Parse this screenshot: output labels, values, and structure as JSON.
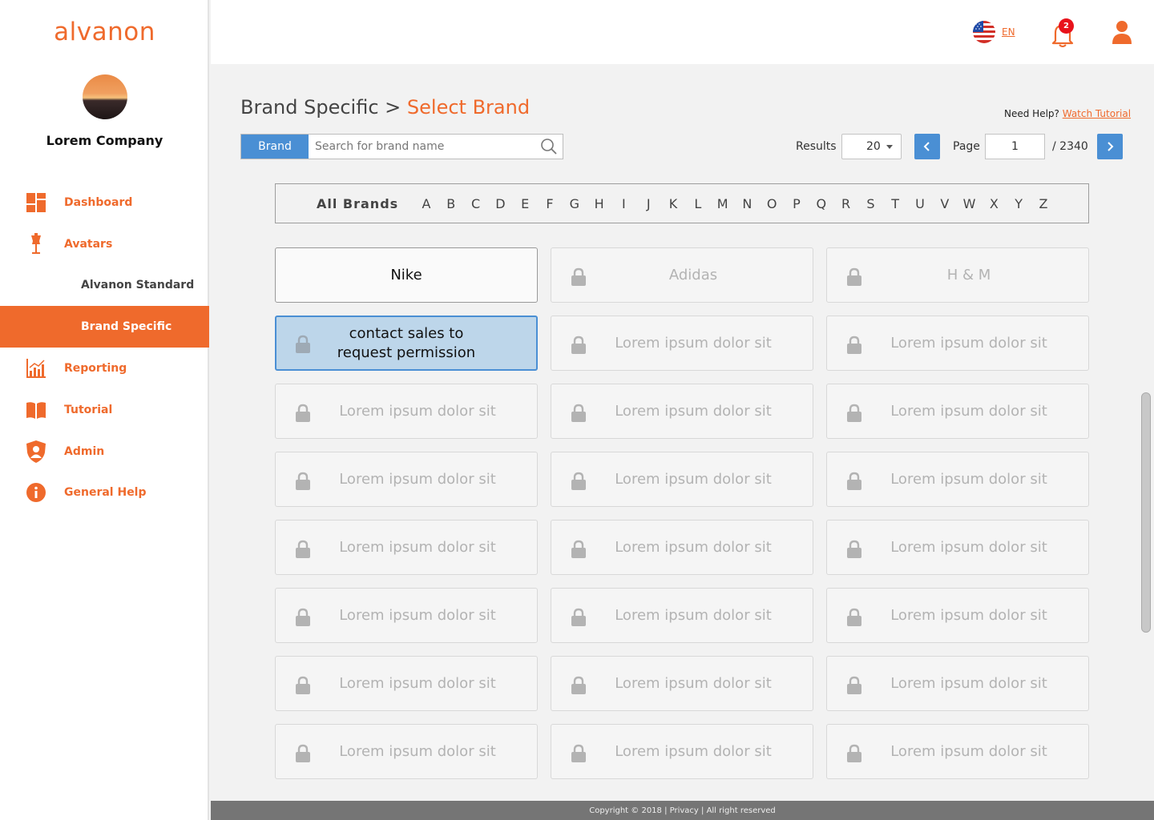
{
  "sidebar": {
    "logo": "alvanon",
    "company": "Lorem Company",
    "nav": [
      {
        "label": "Dashboard",
        "icon": "dashboard-icon"
      },
      {
        "label": "Avatars",
        "icon": "mannequin-icon"
      },
      {
        "label": "Alvanon Standard"
      },
      {
        "label": "Brand Specific",
        "active": true
      },
      {
        "label": "Reporting",
        "icon": "chart-icon"
      },
      {
        "label": "Tutorial",
        "icon": "book-icon"
      },
      {
        "label": "Admin",
        "icon": "shield-user-icon"
      },
      {
        "label": "General Help",
        "icon": "info-icon"
      }
    ]
  },
  "topbar": {
    "language": "EN",
    "notification_count": "2"
  },
  "header": {
    "crumb_parent": "Brand Specific",
    "crumb_sep": ">",
    "crumb_active": "Select Brand",
    "help_text": "Need Help?",
    "help_link": "Watch Tutorial"
  },
  "search": {
    "tab_label": "Brand",
    "placeholder": "Search for brand name"
  },
  "pagination": {
    "results_label": "Results",
    "results_value": "20",
    "page_label": "Page",
    "page_value": "1",
    "page_total": "/ 2340"
  },
  "alphabet": {
    "all_label": "All Brands",
    "letters": [
      "A",
      "B",
      "C",
      "D",
      "E",
      "F",
      "G",
      "H",
      "I",
      "J",
      "K",
      "L",
      "M",
      "N",
      "O",
      "P",
      "Q",
      "R",
      "S",
      "T",
      "U",
      "V",
      "W",
      "X",
      "Y",
      "Z"
    ]
  },
  "brands": [
    {
      "label": "Nike",
      "state": "unlocked"
    },
    {
      "label": "Adidas",
      "state": "locked"
    },
    {
      "label": "H & M",
      "state": "locked"
    },
    {
      "label": "contact sales to request permission",
      "state": "hover"
    },
    {
      "label": "Lorem ipsum dolor sit",
      "state": "locked"
    },
    {
      "label": "Lorem ipsum dolor sit",
      "state": "locked"
    },
    {
      "label": "Lorem ipsum dolor sit",
      "state": "locked"
    },
    {
      "label": "Lorem ipsum dolor sit",
      "state": "locked"
    },
    {
      "label": "Lorem ipsum dolor sit",
      "state": "locked"
    },
    {
      "label": "Lorem ipsum dolor sit",
      "state": "locked"
    },
    {
      "label": "Lorem ipsum dolor sit",
      "state": "locked"
    },
    {
      "label": "Lorem ipsum dolor sit",
      "state": "locked"
    },
    {
      "label": "Lorem ipsum dolor sit",
      "state": "locked"
    },
    {
      "label": "Lorem ipsum dolor sit",
      "state": "locked"
    },
    {
      "label": "Lorem ipsum dolor sit",
      "state": "locked"
    },
    {
      "label": "Lorem ipsum dolor sit",
      "state": "locked"
    },
    {
      "label": "Lorem ipsum dolor sit",
      "state": "locked"
    },
    {
      "label": "Lorem ipsum dolor sit",
      "state": "locked"
    },
    {
      "label": "Lorem ipsum dolor sit",
      "state": "locked"
    },
    {
      "label": "Lorem ipsum dolor sit",
      "state": "locked"
    },
    {
      "label": "Lorem ipsum dolor sit",
      "state": "locked"
    },
    {
      "label": "Lorem ipsum dolor sit",
      "state": "locked"
    },
    {
      "label": "Lorem ipsum dolor sit",
      "state": "locked"
    },
    {
      "label": "Lorem ipsum dolor sit",
      "state": "locked"
    }
  ],
  "footer": "Copyright © 2018 | Privacy | All right reserved",
  "colors": {
    "accent": "#ef6a2c",
    "primary_blue": "#4a8fd4",
    "locked_text": "#b3b3b3"
  }
}
